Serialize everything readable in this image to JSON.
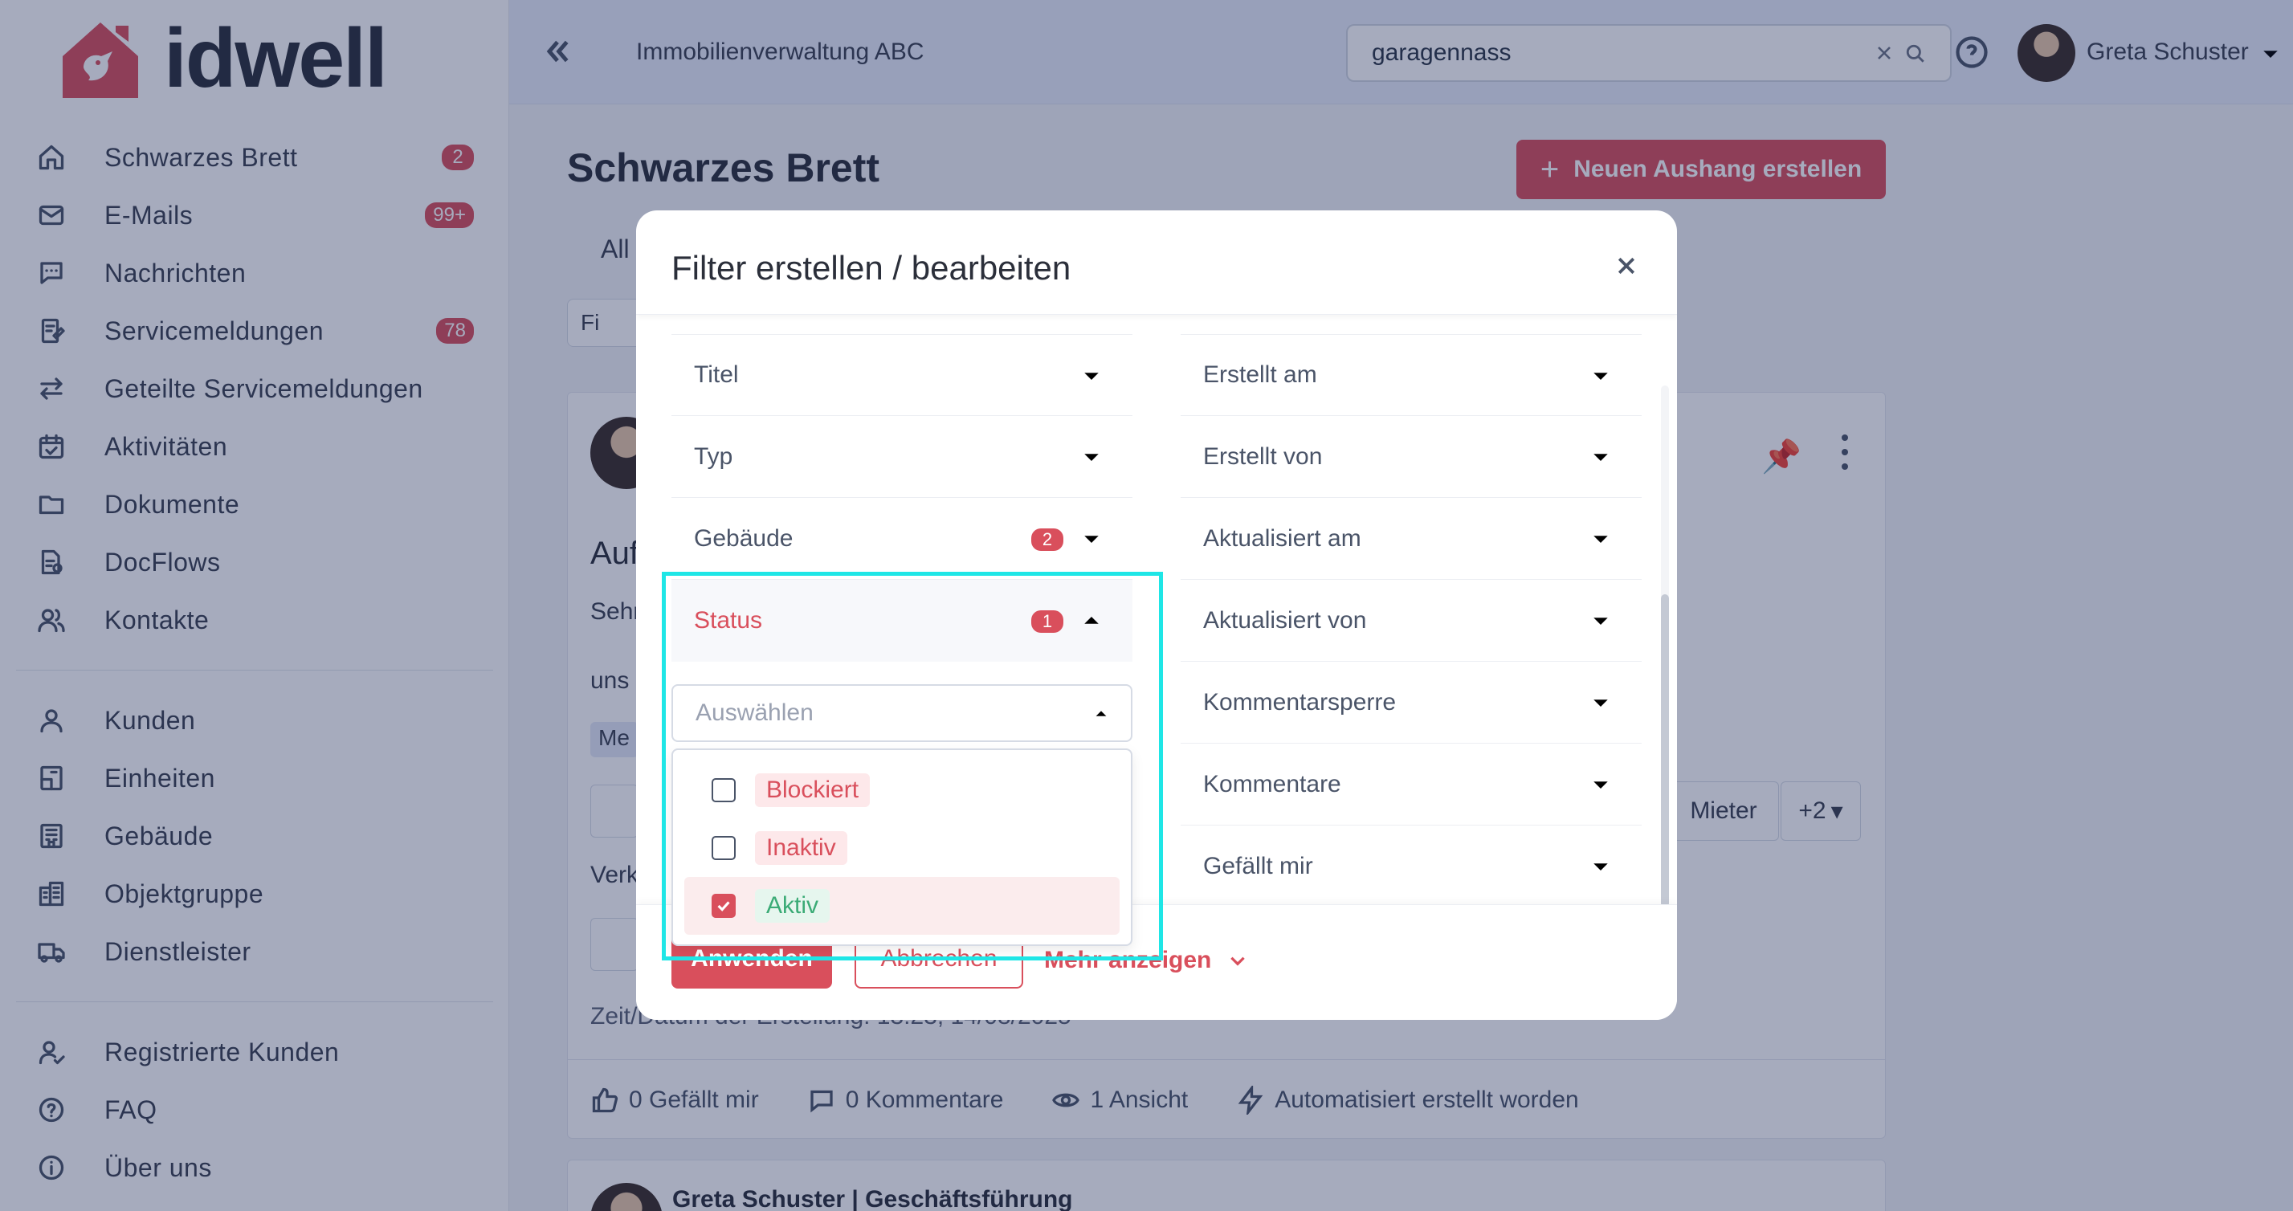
{
  "brand": {
    "name": "idwell",
    "accent": "#d94f5c"
  },
  "sidebar": {
    "items": [
      {
        "label": "Schwarzes Brett",
        "icon": "home-icon",
        "badge": "2"
      },
      {
        "label": "E-Mails",
        "icon": "mail-icon",
        "badge": "99+"
      },
      {
        "label": "Nachrichten",
        "icon": "chat-icon",
        "badge": ""
      },
      {
        "label": "Servicemeldungen",
        "icon": "service-icon",
        "badge": "78"
      },
      {
        "label": "Geteilte Servicemeldungen",
        "icon": "share-arrows-icon",
        "badge": ""
      },
      {
        "label": "Aktivitäten",
        "icon": "calendar-check-icon",
        "badge": ""
      },
      {
        "label": "Dokumente",
        "icon": "folder-icon",
        "badge": ""
      },
      {
        "label": "DocFlows",
        "icon": "docflow-icon",
        "badge": ""
      },
      {
        "label": "Kontakte",
        "icon": "contacts-icon",
        "badge": ""
      }
    ],
    "items2": [
      {
        "label": "Kunden",
        "icon": "user-icon"
      },
      {
        "label": "Einheiten",
        "icon": "unit-icon"
      },
      {
        "label": "Gebäude",
        "icon": "building-icon"
      },
      {
        "label": "Objektgruppe",
        "icon": "building-group-icon"
      },
      {
        "label": "Dienstleister",
        "icon": "truck-icon"
      }
    ],
    "items3": [
      {
        "label": "Registrierte Kunden",
        "icon": "user-check-icon"
      },
      {
        "label": "FAQ",
        "icon": "help-circle-icon"
      },
      {
        "label": "Über uns",
        "icon": "info-icon"
      }
    ]
  },
  "header": {
    "org_name": "Immobilienverwaltung ABC",
    "search_value": "garagennass",
    "user_name": "Greta Schuster"
  },
  "main": {
    "title": "Schwarzes Brett",
    "create_button": "Neuen Aushang erstellen",
    "tab_all": "All",
    "filter_chip": "Fi",
    "post": {
      "title_fragment": "Auf",
      "line1": "Sehr",
      "line2": "uns",
      "tag": "Me",
      "line3": "Verk",
      "time": "Zeit/Datum der Erstellung: 13:23, 14/08/2025",
      "chip_mieter": "Mieter",
      "chip_more": "+2",
      "likes": "0 Gefällt mir",
      "comments": "0 Kommentare",
      "views": "1 Ansicht",
      "automated": "Automatisiert erstellt worden"
    },
    "post2_author": "Greta Schuster | Geschäftsführung"
  },
  "modal": {
    "title": "Filter erstellen / bearbeiten",
    "left_filters": [
      {
        "label": "Titel",
        "badge": ""
      },
      {
        "label": "Typ",
        "badge": ""
      },
      {
        "label": "Gebäude",
        "badge": "2"
      },
      {
        "label": "Status",
        "badge": "1"
      }
    ],
    "right_filters": [
      {
        "label": "Erstellt am"
      },
      {
        "label": "Erstellt von"
      },
      {
        "label": "Aktualisiert am"
      },
      {
        "label": "Aktualisiert von"
      },
      {
        "label": "Kommentarsperre"
      },
      {
        "label": "Kommentare"
      },
      {
        "label": "Gefällt mir"
      }
    ],
    "status_placeholder": "Auswählen",
    "status_options": [
      {
        "label": "Blockiert",
        "checked": false,
        "color": "#d94f5c"
      },
      {
        "label": "Inaktiv",
        "checked": false,
        "color": "#d94f5c"
      },
      {
        "label": "Aktiv",
        "checked": true,
        "color": "#3bab76"
      }
    ],
    "apply": "Anwenden",
    "cancel": "Abbrechen",
    "more": "Mehr anzeigen"
  }
}
